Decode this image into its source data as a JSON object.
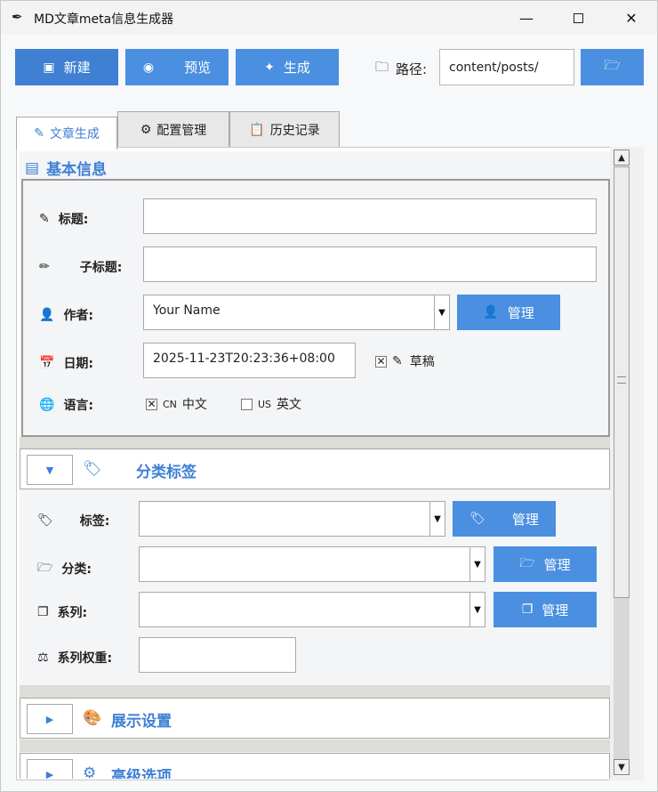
{
  "window": {
    "title": "MD文章meta信息生成器"
  },
  "toolbar": {
    "new_label": "新建",
    "preview_label": "预览",
    "generate_label": "生成",
    "path_label": "路径:",
    "path_value": "content/posts/"
  },
  "tabs": [
    {
      "label": "文章生成"
    },
    {
      "label": "配置管理"
    },
    {
      "label": "历史记录"
    }
  ],
  "basic": {
    "section_title": "基本信息",
    "title_label": "标题:",
    "title_value": "",
    "subtitle_label": "子标题:",
    "subtitle_value": "",
    "author_label": "作者:",
    "author_value": "Your Name",
    "author_manage": "管理",
    "date_label": "日期:",
    "date_value": "2025-11-23T20:23:36+08:00",
    "draft_label": "草稿",
    "draft_checked": true,
    "lang_label": "语言:",
    "lang_cn_flag": "CN",
    "lang_cn_label": "中文",
    "lang_cn_checked": true,
    "lang_us_flag": "US",
    "lang_us_label": "英文",
    "lang_us_checked": false
  },
  "taxonomy": {
    "section_title": "分类标签",
    "tags_label": "标签:",
    "tags_manage": "管理",
    "category_label": "分类:",
    "category_manage": "管理",
    "series_label": "系列:",
    "series_manage": "管理",
    "series_weight_label": "系列权重:"
  },
  "display": {
    "section_title": "展示设置"
  },
  "advanced": {
    "section_title": "高级选项"
  },
  "colors": {
    "accent": "#4a8fe0",
    "accent_dark": "#3f80d3"
  }
}
